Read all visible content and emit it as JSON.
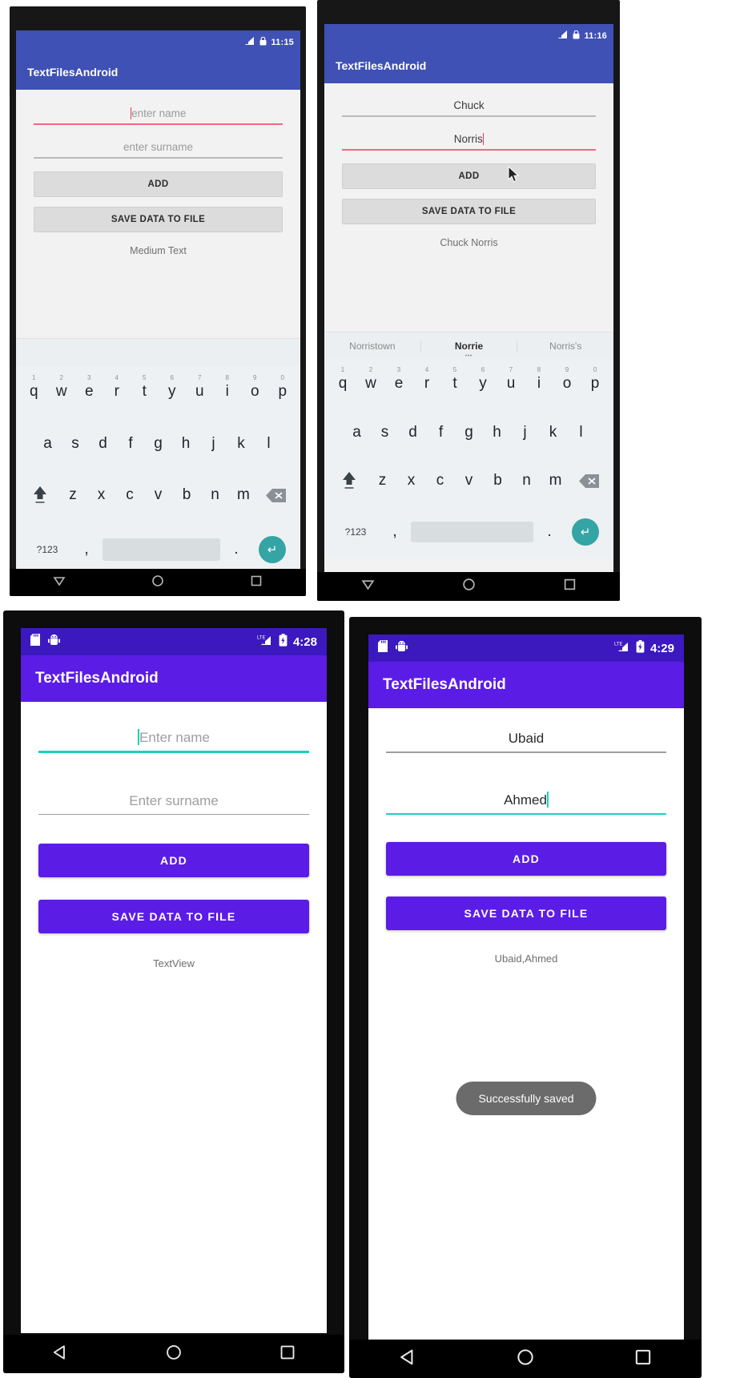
{
  "app": {
    "title": "TextFilesAndroid"
  },
  "panels": {
    "top_left": {
      "status": {
        "time": "11:15",
        "icons": [
          "signal-icon",
          "lock-icon"
        ]
      },
      "title": "TextFilesAndroid",
      "name_field": {
        "value": "",
        "placeholder": "enter name",
        "focused": true
      },
      "surname_field": {
        "value": "",
        "placeholder": "enter surname",
        "focused": false
      },
      "add_button": "ADD",
      "save_button": "SAVE DATA TO FILE",
      "result_text": "Medium Text",
      "suggestions": [
        "",
        "",
        ""
      ],
      "keyboard": {
        "row1": [
          {
            "k": "q",
            "n": "1"
          },
          {
            "k": "w",
            "n": "2"
          },
          {
            "k": "e",
            "n": "3"
          },
          {
            "k": "r",
            "n": "4"
          },
          {
            "k": "t",
            "n": "5"
          },
          {
            "k": "y",
            "n": "6"
          },
          {
            "k": "u",
            "n": "7"
          },
          {
            "k": "i",
            "n": "8"
          },
          {
            "k": "o",
            "n": "9"
          },
          {
            "k": "p",
            "n": "0"
          }
        ],
        "row2": [
          "a",
          "s",
          "d",
          "f",
          "g",
          "h",
          "j",
          "k",
          "l"
        ],
        "row3": [
          "z",
          "x",
          "c",
          "v",
          "b",
          "n",
          "m"
        ],
        "symbols_key": "?123",
        "comma_key": ",",
        "period_key": ".",
        "space_key": "",
        "enter_key": "enter-icon"
      },
      "nav": [
        "back-icon",
        "home-icon",
        "recents-icon"
      ]
    },
    "top_right": {
      "status": {
        "time": "11:16",
        "icons": [
          "signal-icon",
          "lock-icon"
        ]
      },
      "title": "TextFilesAndroid",
      "name_field": {
        "value": "Chuck",
        "placeholder": "enter name",
        "focused": false
      },
      "surname_field": {
        "value": "Norris",
        "placeholder": "enter surname",
        "focused": true
      },
      "add_button": "ADD",
      "save_button": "SAVE DATA TO FILE",
      "result_text": "Chuck Norris",
      "suggestions": [
        "Norristown",
        "Norrie",
        "Norris's"
      ],
      "selected_suggestion_index": 1,
      "keyboard": {
        "row1": [
          {
            "k": "q",
            "n": "1"
          },
          {
            "k": "w",
            "n": "2"
          },
          {
            "k": "e",
            "n": "3"
          },
          {
            "k": "r",
            "n": "4"
          },
          {
            "k": "t",
            "n": "5"
          },
          {
            "k": "y",
            "n": "6"
          },
          {
            "k": "u",
            "n": "7"
          },
          {
            "k": "i",
            "n": "8"
          },
          {
            "k": "o",
            "n": "9"
          },
          {
            "k": "p",
            "n": "0"
          }
        ],
        "row2": [
          "a",
          "s",
          "d",
          "f",
          "g",
          "h",
          "j",
          "k",
          "l"
        ],
        "row3": [
          "z",
          "x",
          "c",
          "v",
          "b",
          "n",
          "m"
        ],
        "symbols_key": "?123",
        "comma_key": ",",
        "period_key": ".",
        "space_key": "",
        "enter_key": "enter-icon"
      },
      "nav": [
        "back-icon",
        "home-icon",
        "recents-icon"
      ],
      "mouse_cursor": true
    },
    "bottom_left": {
      "status": {
        "time": "4:28",
        "icons": [
          "sdcard-icon",
          "android-debug-icon",
          "lte-signal-icon",
          "battery-charging-icon"
        ]
      },
      "title": "TextFilesAndroid",
      "name_field": {
        "value": "",
        "placeholder": "Enter name",
        "focused": true
      },
      "surname_field": {
        "value": "",
        "placeholder": "Enter surname",
        "focused": false
      },
      "add_button": "ADD",
      "save_button": "SAVE DATA TO FILE",
      "result_text": "TextView",
      "nav": [
        "back-icon",
        "home-icon",
        "recents-icon"
      ]
    },
    "bottom_right": {
      "status": {
        "time": "4:29",
        "icons": [
          "sdcard-icon",
          "android-debug-icon",
          "lte-signal-icon",
          "battery-charging-icon"
        ]
      },
      "title": "TextFilesAndroid",
      "name_field": {
        "value": "Ubaid",
        "placeholder": "Enter name",
        "focused": false
      },
      "surname_field": {
        "value": "Ahmed",
        "placeholder": "Enter surname",
        "focused": true
      },
      "add_button": "ADD",
      "save_button": "SAVE DATA TO FILE",
      "result_text": "Ubaid,Ahmed",
      "toast": "Successfully saved",
      "nav": [
        "back-icon",
        "home-icon",
        "recents-icon"
      ]
    }
  },
  "colors": {
    "old_appbar": "#3f51b5",
    "new_appbar": "#5b1ce6",
    "new_statusbar": "#3b19bf",
    "accent_teal": "#17d1c0",
    "focus_pink": "#f1697f",
    "enter_key": "#34a4a4",
    "toast_bg": "#6b6b6b"
  }
}
